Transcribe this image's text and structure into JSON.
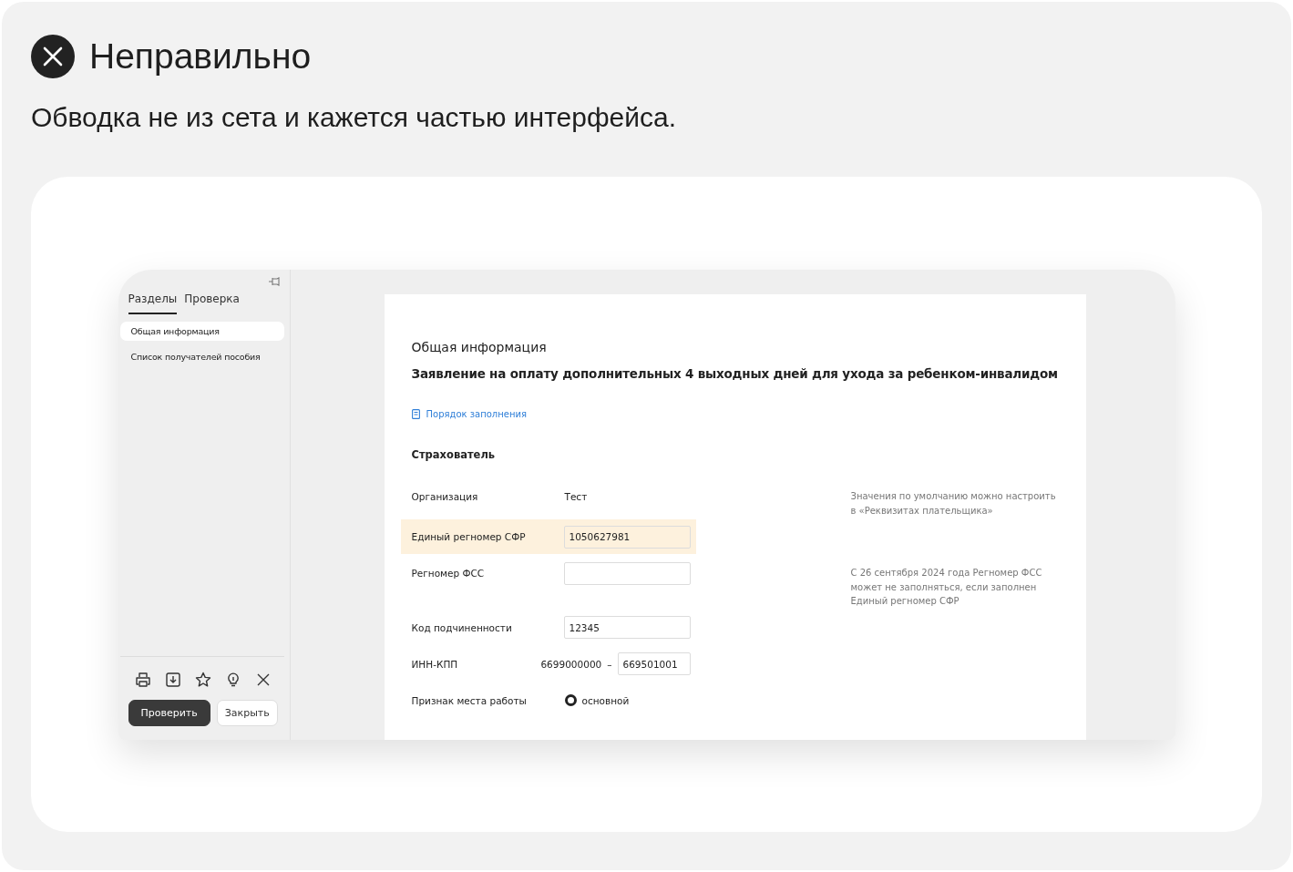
{
  "header": {
    "title": "Неправильно",
    "subtitle": "Обводка не из сета и кажется частью интерфейса."
  },
  "app": {
    "sidebar": {
      "tabs": [
        {
          "label": "Разделы",
          "selected": true
        },
        {
          "label": "Проверка",
          "selected": false
        }
      ],
      "items": [
        {
          "label": "Общая информация",
          "selected": true
        },
        {
          "label": "Список получателей пособия",
          "selected": false
        }
      ],
      "buttons": [
        {
          "label": "Проверить",
          "kind": "primary"
        },
        {
          "label": "Закрыть",
          "kind": "secondary"
        }
      ]
    },
    "document": {
      "section": "Общая информация",
      "title": "Заявление на оплату дополнительных 4 выходных дней для ухода за ребенком-инвалидом",
      "help_link": "Порядок заполнения",
      "group": "Страхователь",
      "fields": [
        {
          "kind": "text",
          "label": "Организация",
          "value": "Тест",
          "hint": "Значения по умолчанию можно настроить в «Реквизитах плательщика»",
          "highlighted": false
        },
        {
          "kind": "input",
          "label": "Единый регномер СФР",
          "value": "1050627981",
          "highlighted": true
        },
        {
          "kind": "input",
          "label": "Регномер ФСС",
          "hint": "С 26 сентября 2024 года Регномер ФСС может не заполняться, если заполнен Единый регномер СФР",
          "highlighted": false
        },
        {
          "kind": "input",
          "label": "Код подчиненности",
          "value": "12345",
          "highlighted": false
        },
        {
          "kind": "pair",
          "label": "ИНН-КПП",
          "value": "6699000000",
          "separator": "–",
          "second_value": "669501001",
          "highlighted": false
        },
        {
          "kind": "radio",
          "label": "Признак места работы",
          "option": "основной",
          "selected": true,
          "highlighted": false
        }
      ]
    }
  }
}
